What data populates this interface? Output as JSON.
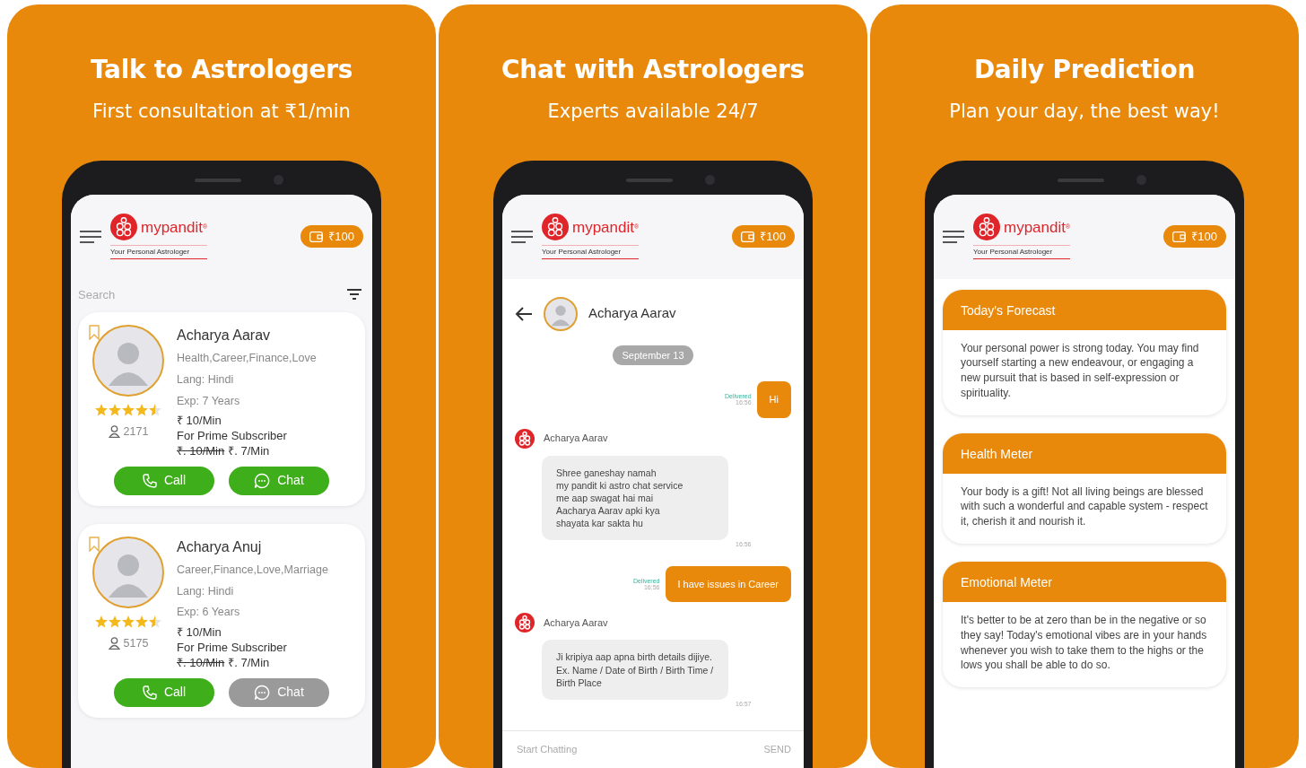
{
  "panels": [
    {
      "kind": "astrologers",
      "title": "Talk to Astrologers",
      "subtitle": "First consultation at ₹1/min",
      "app_header": {
        "logo_text": "mypandit",
        "logo_mark": "®",
        "tagline": "Your Personal Astrologer",
        "wallet": "₹100"
      },
      "search": {
        "placeholder": "Search"
      },
      "astrologers": [
        {
          "name": "Acharya Aarav",
          "categories": "Health,Career,Finance,Love",
          "language": "Lang: Hindi",
          "experience": "Exp: 7 Years",
          "price": "₹ 10/Min",
          "prime_label": "For Prime Subscriber",
          "old_price": "₹. 10/Min",
          "prime_price": "₹. 7/Min",
          "stars": 4.5,
          "followers": "2171",
          "call_label": "Call",
          "chat_label": "Chat",
          "chat_disabled": false
        },
        {
          "name": "Acharya Anuj",
          "categories": "Career,Finance,Love,Marriage",
          "language": "Lang: Hindi",
          "experience": "Exp: 6 Years",
          "price": "₹ 10/Min",
          "prime_label": "For Prime Subscriber",
          "old_price": "₹. 10/Min",
          "prime_price": "₹. 7/Min",
          "stars": 4.5,
          "followers": "5175",
          "call_label": "Call",
          "chat_label": "Chat",
          "chat_disabled": true
        }
      ]
    },
    {
      "kind": "chat",
      "title": "Chat with Astrologers",
      "subtitle": "Experts available 24/7",
      "app_header": {
        "logo_text": "mypandit",
        "logo_mark": "®",
        "tagline": "Your Personal Astrologer",
        "wallet": "₹100"
      },
      "contact": "Acharya Aarav",
      "date": "September 13",
      "messages": [
        {
          "kind": "sent",
          "text": "Hi",
          "status": "Delivered",
          "time": "16:56"
        },
        {
          "kind": "received",
          "sender": "Acharya Aarav",
          "text": "Shree ganeshay namah\nmy pandit ki astro chat service\nme aap swagat hai mai\nAacharya Aarav apki kya\nshayata kar sakta hu",
          "time": "16:56"
        },
        {
          "kind": "sent",
          "text": "I have issues in Career",
          "status": "Delivered",
          "time": "16:56"
        },
        {
          "kind": "received",
          "sender": "Acharya Aarav",
          "text": "Ji kripiya aap apna birth details dijiye. Ex. Name / Date of Birth / Birth Time / Birth Place",
          "time": "16:57"
        }
      ],
      "input": {
        "placeholder": "Start Chatting",
        "send": "SEND"
      }
    },
    {
      "kind": "forecast",
      "title": "Daily Prediction",
      "subtitle": "Plan your day, the best way!",
      "app_header": {
        "logo_text": "mypandit",
        "logo_mark": "®",
        "tagline": "Your Personal Astrologer",
        "wallet": "₹100"
      },
      "sections": [
        {
          "title": "Today's Forecast",
          "text": "Your personal power is strong today. You may find yourself starting a new endeavour, or engaging a new pursuit that is based in self-expression or spirituality."
        },
        {
          "title": "Health Meter",
          "text": "Your body is a gift! Not all living beings are blessed with such a wonderful and capable system - respect it, cherish it and nourish it."
        },
        {
          "title": "Emotional Meter",
          "text": "It's better to be at zero than be in the negative or so they say! Today's emotional vibes are in your hands whenever you wish to take them to the highs or the lows you shall be able to do so."
        }
      ]
    }
  ]
}
